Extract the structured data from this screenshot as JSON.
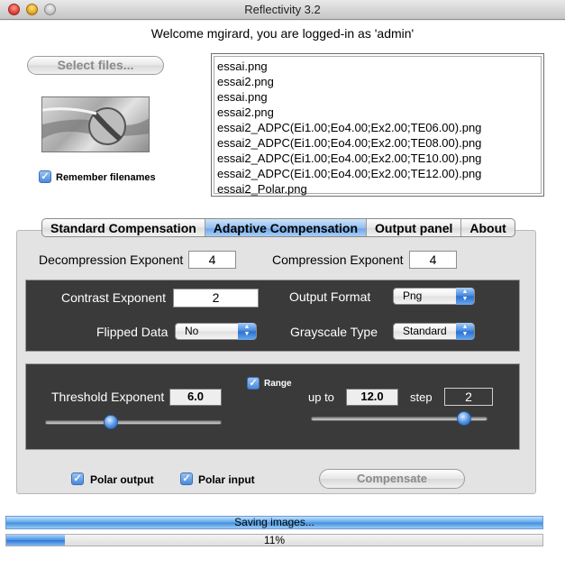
{
  "window": {
    "title": "Reflectivity 3.2"
  },
  "welcome": "Welcome mgirard, you are logged-in as 'admin'",
  "select_files_label": "Select files...",
  "remember_filenames_label": "Remember filenames",
  "remember_filenames_checked": true,
  "files": [
    "essai.png",
    "essai2.png",
    "essai.png",
    "essai2.png",
    "essai2_ADPC(Ei1.00;Eo4.00;Ex2.00;TE06.00).png",
    "essai2_ADPC(Ei1.00;Eo4.00;Ex2.00;TE08.00).png",
    "essai2_ADPC(Ei1.00;Eo4.00;Ex2.00;TE10.00).png",
    "essai2_ADPC(Ei1.00;Eo4.00;Ex2.00;TE12.00).png",
    "essai2_Polar.png"
  ],
  "tabs": [
    {
      "label": "Standard Compensation",
      "active": false
    },
    {
      "label": "Adaptive Compensation",
      "active": true
    },
    {
      "label": "Output panel",
      "active": false
    },
    {
      "label": "About",
      "active": false
    }
  ],
  "panel": {
    "decompression_label": "Decompression Exponent",
    "decompression_value": "4",
    "compression_label": "Compression Exponent",
    "compression_value": "4",
    "contrast_label": "Contrast Exponent",
    "contrast_value": "2",
    "output_format_label": "Output Format",
    "output_format_value": "Png",
    "flipped_label": "Flipped Data",
    "flipped_value": "No",
    "grayscale_label": "Grayscale Type",
    "grayscale_value": "Standard",
    "threshold_label": "Threshold Exponent",
    "threshold_value": "6.0",
    "range_label": "Range",
    "range_checked": true,
    "upto_label": "up to",
    "upto_value": "12.0",
    "step_label": "step",
    "step_value": "2",
    "polar_output_label": "Polar output",
    "polar_output_checked": true,
    "polar_input_label": "Polar input",
    "polar_input_checked": true,
    "compensate_label": "Compensate"
  },
  "status": {
    "message": "Saving images...",
    "progress_text": "11%",
    "progress": 0.11
  }
}
